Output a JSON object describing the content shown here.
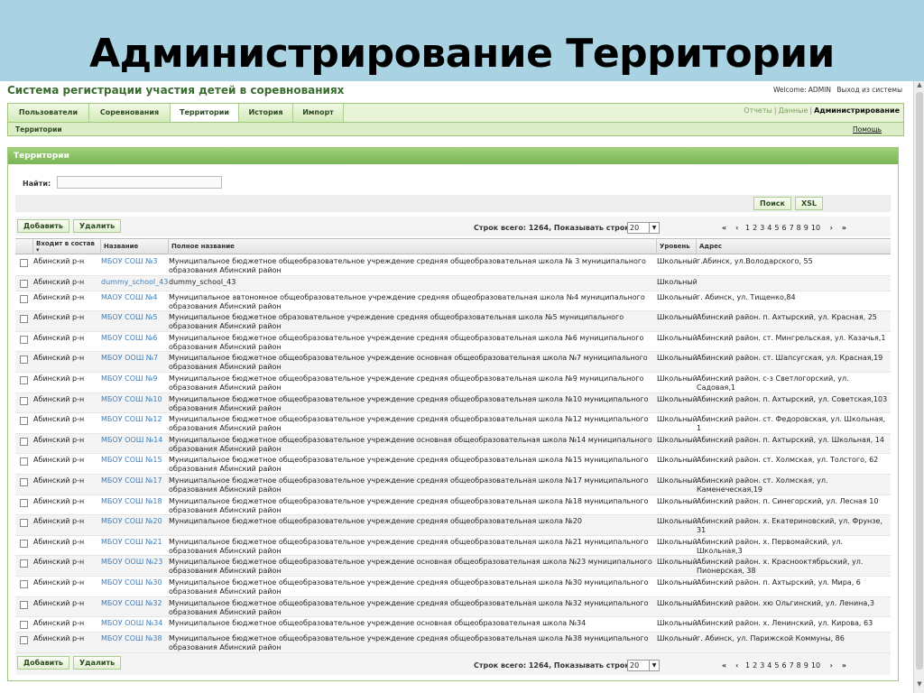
{
  "slide": {
    "title": "Администрирование Территории"
  },
  "app": {
    "title": "Система регистрации участия детей в соревнованиях",
    "welcome_prefix": "Welcome:",
    "welcome_user": "ADMIN",
    "logout": "Выход из системы"
  },
  "tabs": [
    {
      "label": "Пользователи"
    },
    {
      "label": "Соревнования"
    },
    {
      "label": "Территории"
    },
    {
      "label": "История"
    },
    {
      "label": "Импорт"
    }
  ],
  "right_links": {
    "reports": "Отчеты",
    "data": "Данные",
    "admin": "Администрирование"
  },
  "subbar": {
    "left": "Территории",
    "help": "Помощь"
  },
  "panel": {
    "title": "Территории"
  },
  "search": {
    "label": "Найти:",
    "value": "",
    "search_button": "Поиск",
    "xsl_button": "XSL"
  },
  "actions": {
    "add": "Добавить",
    "delete": "Удалить"
  },
  "pager": {
    "summary": "Строк всего: 1264, Показывать строк:",
    "rows_per_page": "20",
    "first": "«",
    "prev": "‹",
    "next": "›",
    "last": "»",
    "pages": [
      "1",
      "2",
      "3",
      "4",
      "5",
      "6",
      "7",
      "8",
      "9",
      "10"
    ]
  },
  "columns": {
    "part_of": "Входит в состав",
    "sort_icon": "sort-desc-icon",
    "name": "Название",
    "full_name": "Полное название",
    "level": "Уровень",
    "address": "Адрес"
  },
  "rows": [
    {
      "territory": "Абинский р-н",
      "name": "МБОУ СОШ №3",
      "full": "Муниципальное бюджетное общеобразовательное учреждение средняя общеобразовательная школа № 3 муниципального образования Абинский район",
      "level": "Школьный",
      "address": "г.Абинск, ул.Володарского, 55"
    },
    {
      "territory": "Абинский р-н",
      "name": "dummy_school_43",
      "full": "dummy_school_43",
      "level": "Школьный",
      "address": ""
    },
    {
      "territory": "Абинский р-н",
      "name": "МАОУ СОШ №4",
      "full": "Муниципальное автономное общеобразовательное учреждение средняя общеобразовательная школа №4 муниципального образования Абинский район",
      "level": "Школьный",
      "address": "г. Абинск, ул. Тищенко,84"
    },
    {
      "territory": "Абинский р-н",
      "name": "МБОУ СОШ №5",
      "full": "Муниципальное бюджетное образовательное учреждение средняя общеобразовательная школа №5 муниципального образования Абинский район",
      "level": "Школьный",
      "address": "Абинский район. п. Ахтырский, ул. Красная, 25"
    },
    {
      "territory": "Абинский р-н",
      "name": "МБОУ СОШ №6",
      "full": "Муниципальное бюджетное общеобразовательное учреждение средняя общеобразовательная школа №6 муниципального образования Абинский район",
      "level": "Школьный",
      "address": "Абинский район. ст. Мингрельская, ул. Казачья,1"
    },
    {
      "territory": "Абинский р-н",
      "name": "МБОУ ООШ №7",
      "full": "Муниципальное бюджетное общеобразовательное учреждение основная общеобразовательная школа №7 муниципального образования Абинский район",
      "level": "Школьный",
      "address": "Абинский район. ст. Шапсугская, ул. Красная,19"
    },
    {
      "territory": "Абинский р-н",
      "name": "МБОУ СОШ №9",
      "full": "Муниципальное бюджетное общеобразовательное учреждение средняя общеобразовательная школа №9 муниципального образования Абинский район",
      "level": "Школьный",
      "address": "Абинский район. с-з Светлогорский, ул. Садовая,1"
    },
    {
      "territory": "Абинский р-н",
      "name": "МБОУ СОШ №10",
      "full": "Муниципальное бюджетное общеобразовательное учреждение средняя общеобразовательная школа №10 муниципального образования Абинский район",
      "level": "Школьный",
      "address": "Абинский район. п. Ахтырский, ул. Советская,103"
    },
    {
      "territory": "Абинский р-н",
      "name": "МБОУ СОШ №12",
      "full": "Муниципальное бюджетное общеобразовательное учреждение средняя общеобразовательная школа №12 муниципального образования Абинский район",
      "level": "Школьный",
      "address": "Абинский район. ст. Федоровская, ул. Школьная, 1"
    },
    {
      "territory": "Абинский р-н",
      "name": "МБОУ ООШ №14",
      "full": "Муниципальное бюджетное общеобразовательное учреждение основная общеобразовательная школа №14 муниципального образования Абинский район",
      "level": "Школьный",
      "address": "Абинский район. п. Ахтырский, ул. Школьная, 14"
    },
    {
      "territory": "Абинский р-н",
      "name": "МБОУ СОШ №15",
      "full": "Муниципальное бюджетное общеобразовательное учреждение средняя общеобразовательная школа №15 муниципального образования Абинский район",
      "level": "Школьный",
      "address": "Абинский район. ст. Холмская, ул. Толстого, 62"
    },
    {
      "territory": "Абинский р-н",
      "name": "МБОУ СОШ №17",
      "full": "Муниципальное бюджетное общеобразовательное учреждение средняя общеобразовательная школа №17 муниципального образования Абинский район",
      "level": "Школьный",
      "address": "Абинский район. ст. Холмская, ул. Каменеческая,19"
    },
    {
      "territory": "Абинский р-н",
      "name": "МБОУ СОШ №18",
      "full": "Муниципальное бюджетное общеобразовательное учреждение средняя общеобразовательная школа №18 муниципального образования Абинский район",
      "level": "Школьный",
      "address": "Абинский район. п. Синегорский, ул. Лесная 10"
    },
    {
      "territory": "Абинский р-н",
      "name": "МБОУ СОШ №20",
      "full": "Муниципальное бюджетное общеобразовательное учреждение средняя общеобразовательная школа №20",
      "level": "Школьный",
      "address": "Абинский район. х. Екатериновский, ул. Фрунзе, 31"
    },
    {
      "territory": "Абинский р-н",
      "name": "МБОУ СОШ №21",
      "full": "Муниципальное бюджетное общеобразовательное учреждение средняя общеобразовательная школа №21 муниципального образования Абинский район",
      "level": "Школьный",
      "address": "Абинский район. х. Первомайский, ул. Школьная,3"
    },
    {
      "territory": "Абинский р-н",
      "name": "МБОУ ООШ №23",
      "full": "Муниципальное бюджетное общеобразовательное учреждение основная общеобразовательная школа №23 муниципального образования Абинский район",
      "level": "Школьный",
      "address": "Абинский район. х. Краснооктябрьский, ул. Пионерская, 38"
    },
    {
      "territory": "Абинский р-н",
      "name": "МБОУ СОШ №30",
      "full": "Муниципальное бюджетное общеобразовательное учреждение средняя общеобразовательная школа №30 муниципального образования Абинский район",
      "level": "Школьный",
      "address": "Абинский район. п. Ахтырский, ул. Мира, 6"
    },
    {
      "territory": "Абинский р-н",
      "name": "МБОУ СОШ №32",
      "full": "Муниципальное бюджетное общеобразовательное учреждение средняя общеобразовательная школа №32 муниципального образования Абинский район",
      "level": "Школьный",
      "address": "Абинский район. хю Ольгинский, ул. Ленина,3"
    },
    {
      "territory": "Абинский р-н",
      "name": "МБОУ ООШ №34",
      "full": "Муниципальное бюджетное общеобразовательное учреждение основная общеобразовательная школа №34",
      "level": "Школьный",
      "address": "Абинский район. х. Ленинский, ул. Кирова, 63"
    },
    {
      "territory": "Абинский р-н",
      "name": "МБОУ СОШ №38",
      "full": "Муниципальное бюджетное общеобразовательное учреждение средняя общеобразовательная школа №38 муниципального образования Абинский район",
      "level": "Школьный",
      "address": "г. Абинск, ул. Парижской Коммуны, 86"
    }
  ]
}
